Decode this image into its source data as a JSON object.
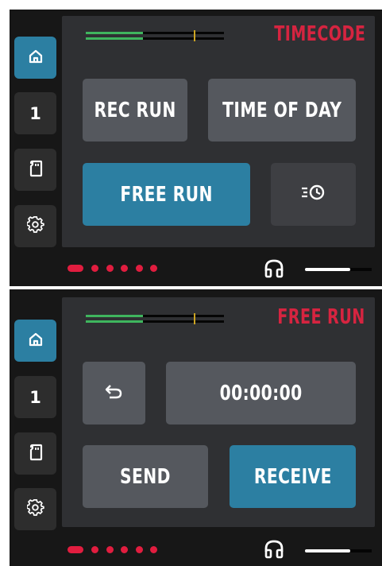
{
  "colors": {
    "accent": "#2c7fa2",
    "mode_title": "#d62440",
    "page_indicator": "#e11d3f",
    "button": "#55585e",
    "meter_green": "#3fb55e",
    "meter_peak": "#cca422"
  },
  "sidebar": {
    "items": [
      {
        "icon": "home-icon",
        "active": true
      },
      {
        "label": "1"
      },
      {
        "icon": "sd-card-icon"
      },
      {
        "icon": "gear-icon"
      }
    ]
  },
  "screens": [
    {
      "title": "TIMECODE",
      "buttons": {
        "rec_run": "REC RUN",
        "time_of_day": "TIME OF DAY",
        "free_run": "FREE RUN",
        "history_icon": "list-clock-icon"
      },
      "page_count": 6,
      "current_page": 1,
      "volume_level": 0.68
    },
    {
      "title": "FREE RUN",
      "buttons": {
        "back_icon": "undo-arrow-icon",
        "timecode_value": "00:00:00",
        "send": "SEND",
        "receive": "RECEIVE"
      },
      "page_count": 6,
      "current_page": 1,
      "volume_level": 0.68
    }
  ]
}
